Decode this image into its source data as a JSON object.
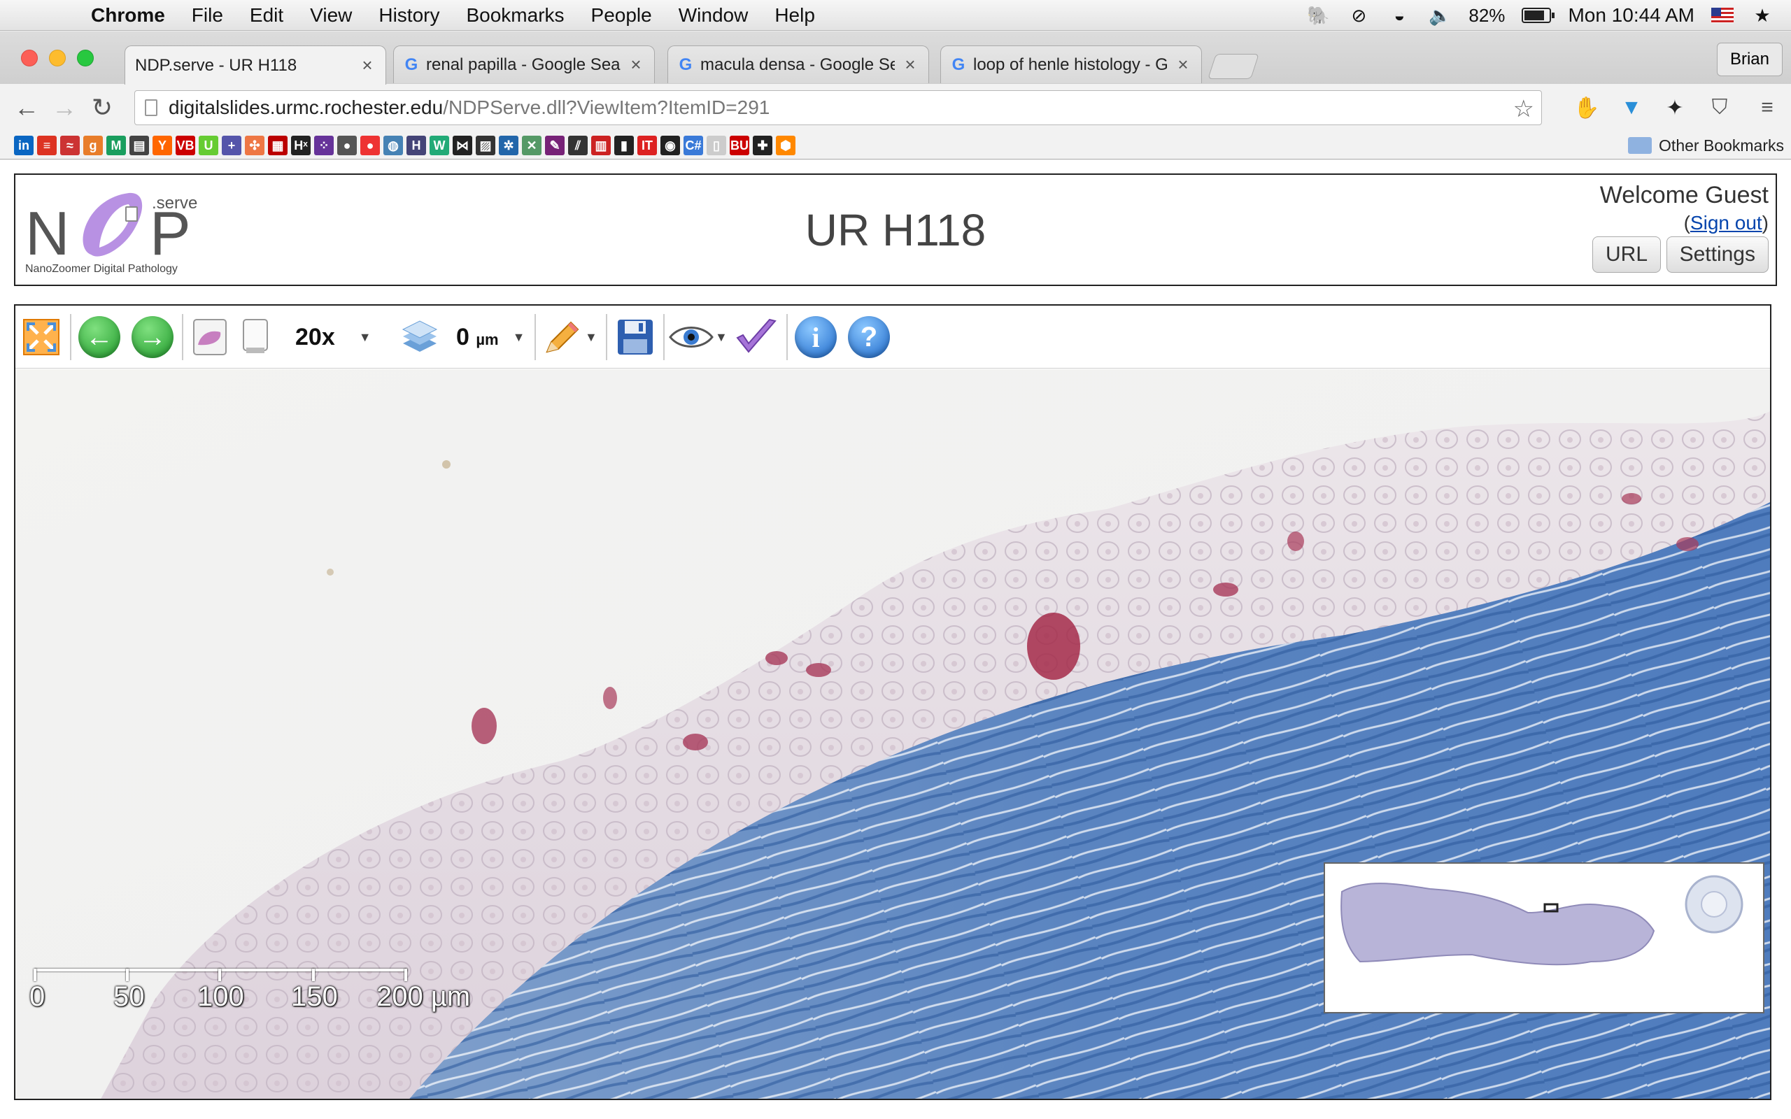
{
  "menubar": {
    "app": "Chrome",
    "items": [
      "File",
      "Edit",
      "View",
      "History",
      "Bookmarks",
      "People",
      "Window",
      "Help"
    ],
    "battery": "82%",
    "battery_level": 0.82,
    "clock": "Mon 10:44 AM"
  },
  "tabs": [
    {
      "title": "NDP.serve - UR H118",
      "favicon": "page-icon",
      "active": true
    },
    {
      "title": "renal papilla - Google Search",
      "favicon": "google-icon",
      "active": false
    },
    {
      "title": "macula densa - Google Search",
      "favicon": "google-icon",
      "active": false
    },
    {
      "title": "loop of henle histology - Google Search",
      "favicon": "google-icon",
      "active": false
    }
  ],
  "profile": "Brian",
  "address": {
    "host": "digitalslides.urmc.rochester.edu",
    "path": "/NDPServe.dll?ViewItem?ItemID=291"
  },
  "bookmarks": {
    "other": "Other Bookmarks",
    "icons": [
      {
        "name": "linkedin-icon",
        "glyph": "in",
        "color": "#0a66c2"
      },
      {
        "name": "stack-icon",
        "glyph": "≡",
        "color": "#d32"
      },
      {
        "name": "bank-icon",
        "glyph": "≈",
        "color": "#c33"
      },
      {
        "name": "goodreads-icon",
        "glyph": "g",
        "color": "#e87d2a"
      },
      {
        "name": "medium-icon",
        "glyph": "M",
        "color": "#1a9e5e"
      },
      {
        "name": "news-icon",
        "glyph": "▤",
        "color": "#444"
      },
      {
        "name": "hackernews-icon",
        "glyph": "Y",
        "color": "#f60"
      },
      {
        "name": "vb-icon",
        "glyph": "VB",
        "color": "#c00"
      },
      {
        "name": "u-icon",
        "glyph": "U",
        "color": "#6c3"
      },
      {
        "name": "plus-icon",
        "glyph": "+",
        "color": "#55a"
      },
      {
        "name": "pinwheel-icon",
        "glyph": "✣",
        "color": "#e74"
      },
      {
        "name": "grid-icon",
        "glyph": "▦",
        "color": "#b00"
      },
      {
        "name": "hx-icon",
        "glyph": "Hˣ",
        "color": "#222"
      },
      {
        "name": "dots-icon",
        "glyph": "⁘",
        "color": "#639"
      },
      {
        "name": "press-icon",
        "glyph": "●",
        "color": "#555"
      },
      {
        "name": "tomato-icon",
        "glyph": "●",
        "color": "#e33"
      },
      {
        "name": "database-icon",
        "glyph": "◍",
        "color": "#4682b4"
      },
      {
        "name": "h-icon",
        "glyph": "H",
        "color": "#447"
      },
      {
        "name": "w-icon",
        "glyph": "W",
        "color": "#2a7"
      },
      {
        "name": "bow-icon",
        "glyph": "⋈",
        "color": "#222"
      },
      {
        "name": "stripes-icon",
        "glyph": "▨",
        "color": "#333"
      },
      {
        "name": "octopus-icon",
        "glyph": "✲",
        "color": "#26a"
      },
      {
        "name": "scatter-icon",
        "glyph": "✕",
        "color": "#596"
      },
      {
        "name": "feather-icon",
        "glyph": "✎",
        "color": "#727"
      },
      {
        "name": "lines-icon",
        "glyph": "⫽",
        "color": "#333"
      },
      {
        "name": "chart-icon",
        "glyph": "▥",
        "color": "#c22"
      },
      {
        "name": "jar-icon",
        "glyph": "▮",
        "color": "#222"
      },
      {
        "name": "it-icon",
        "glyph": "IT",
        "color": "#d22"
      },
      {
        "name": "wolf-icon",
        "glyph": "◉",
        "color": "#222"
      },
      {
        "name": "csharp-icon",
        "glyph": "C#",
        "color": "#3a7ad8"
      },
      {
        "name": "blank-page-icon",
        "glyph": "▯",
        "color": "#ccc"
      },
      {
        "name": "bu-icon",
        "glyph": "BU",
        "color": "#c00"
      },
      {
        "name": "cross-icon",
        "glyph": "✚",
        "color": "#222"
      },
      {
        "name": "hexagon-icon",
        "glyph": "⬢",
        "color": "#f80"
      }
    ]
  },
  "ndp": {
    "logo_main": "NDP",
    "logo_sup": ".serve",
    "logo_tagline": "NanoZoomer Digital Pathology",
    "title": "UR H118",
    "welcome": "Welcome Guest",
    "signout_open": "(",
    "signout": "Sign out",
    "signout_close": ")",
    "url_button": "URL",
    "settings_button": "Settings"
  },
  "viewer_toolbar": {
    "zoom": "20x",
    "focus_value": "0",
    "focus_unit": "µm"
  },
  "scalebar": {
    "labels": [
      "0",
      "50",
      "100",
      "150",
      "200 µm"
    ]
  }
}
